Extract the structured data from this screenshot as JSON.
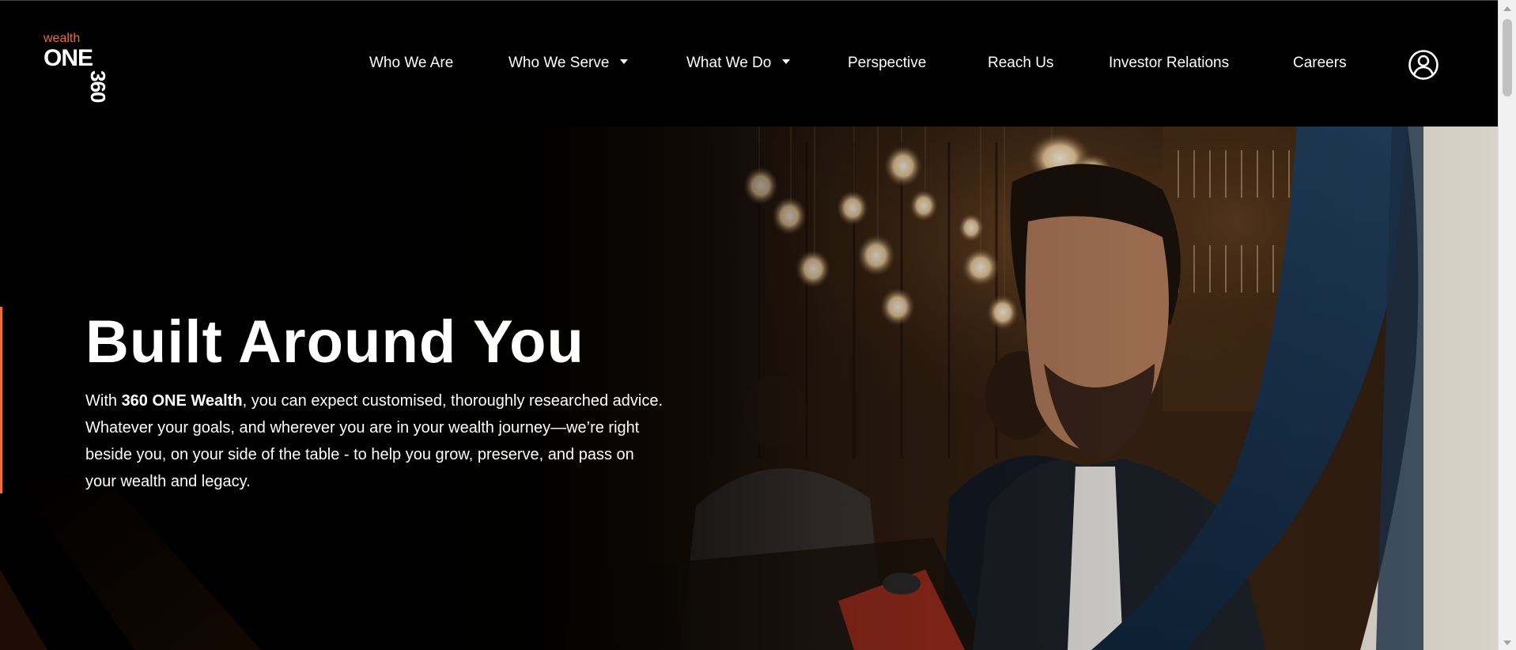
{
  "brand": {
    "wealth": "wealth",
    "one": "ONE",
    "number": "360",
    "accent_color": "#e8703a"
  },
  "nav": {
    "items": [
      {
        "label": "Who We Are",
        "dropdown": false
      },
      {
        "label": "Who We Serve",
        "dropdown": true
      },
      {
        "label": "What We Do",
        "dropdown": true
      },
      {
        "label": "Perspective",
        "dropdown": false
      },
      {
        "label": "Reach Us",
        "dropdown": false
      },
      {
        "label": "Investor Relations",
        "dropdown": false
      },
      {
        "label": "Careers",
        "dropdown": false
      }
    ],
    "account_icon": "user-circle-icon"
  },
  "hero": {
    "title": "Built Around You",
    "text_prefix": "With ",
    "text_brand": "360 ONE Wealth",
    "text_rest": ", you can expect customised, thoroughly researched advice. Whatever your goals, and wherever you are in your wealth journey—we’re right beside you, on your side of the table - to help you grow, preserve, and pass on your wealth and legacy."
  }
}
